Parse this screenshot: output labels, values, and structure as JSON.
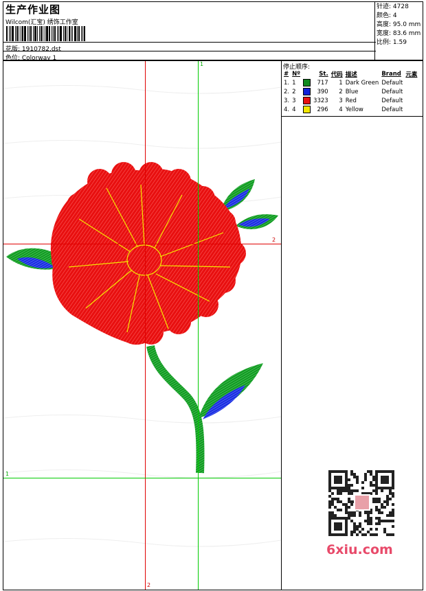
{
  "header": {
    "title": "生产作业图",
    "subtitle": "Wilcom(汇宝) 绣饰工作室",
    "design_line": "花版:  1910782.dst",
    "colorway_line": "色位:  Colorway 1"
  },
  "stats": {
    "stitches": "针迹:  4728",
    "colors": "颜色:  4",
    "height": "高度:  95.0 mm",
    "width": "宽度:  83.6 mm",
    "scale": "比例:  1.59"
  },
  "stop_sequence": {
    "title": "停止顺序:",
    "columns": {
      "hash": "#",
      "no": "Nº",
      "st": "St.",
      "code": "代码",
      "desc": "描述",
      "brand": "Brand",
      "element": "元素"
    },
    "rows": [
      {
        "idx": "1.",
        "no": "1",
        "color": "#0f8a1e",
        "st": "717",
        "code": "1",
        "desc": "Dark Green",
        "brand": "Default"
      },
      {
        "idx": "2.",
        "no": "2",
        "color": "#1020d8",
        "st": "390",
        "code": "2",
        "desc": "Blue",
        "brand": "Default"
      },
      {
        "idx": "3.",
        "no": "3",
        "color": "#e81010",
        "st": "3323",
        "code": "3",
        "desc": "Red",
        "brand": "Default"
      },
      {
        "idx": "4.",
        "no": "4",
        "color": "#f2e600",
        "st": "296",
        "code": "4",
        "desc": "Yellow",
        "brand": "Default"
      }
    ]
  },
  "guides": {
    "green_top": "1",
    "green_left": "1",
    "red_right": "2",
    "red_bottom": "2"
  },
  "watermark": "6xiu.com",
  "colors": {
    "red_guide": "#e00000",
    "green_guide": "#00cc00",
    "red": "#e81010",
    "green": "#129a22",
    "blue": "#1a2ee0",
    "yellow": "#f5e800"
  }
}
